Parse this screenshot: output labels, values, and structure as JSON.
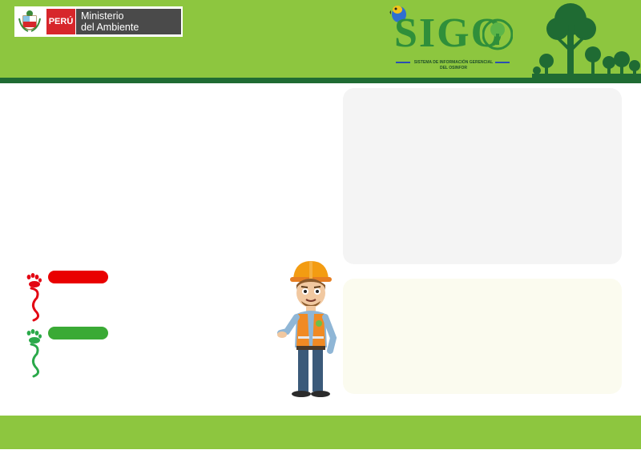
{
  "header": {
    "gov_logo": {
      "country": "PERÚ",
      "ministry_line1": "Ministerio",
      "ministry_line2": "del Ambiente",
      "shield_icon": "peru-coat-of-arms-icon"
    },
    "app_logo": {
      "name": "SIGO",
      "subtitle_line1": "SISTEMA DE INFORMACIÓN GERENCIAL",
      "subtitle_line2": "DEL OSINFOR",
      "icons": [
        "parrot-icon",
        "tree-icon"
      ]
    },
    "decoration": "forest-silhouette"
  },
  "indicators": [
    {
      "color": "#e90000",
      "icon": "footprint-icon"
    },
    {
      "color": "#3aaa35",
      "icon": "footprint-icon"
    }
  ],
  "illustration": "forest-worker",
  "colors": {
    "header_green": "#8dc63f",
    "stripe_dark_green": "#1f6b33",
    "panel_gray": "#f4f4f4",
    "panel_cream": "#fbfbef",
    "logo_green": "#2f8f3a"
  }
}
